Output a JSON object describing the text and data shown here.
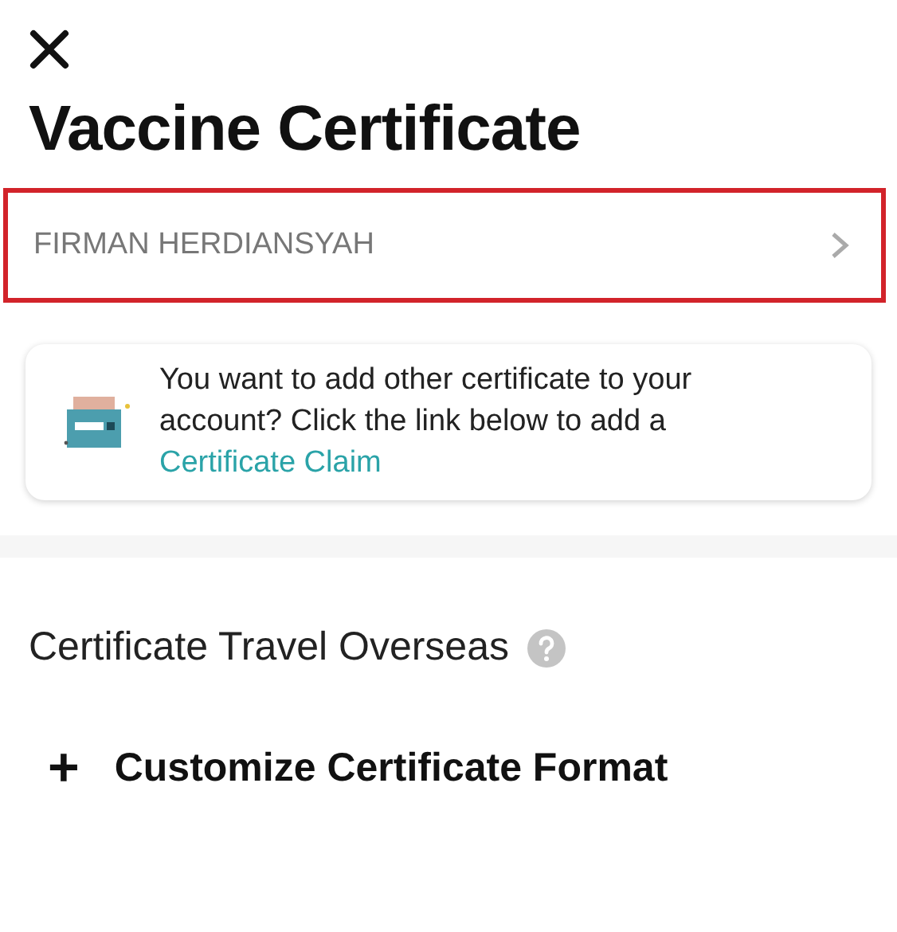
{
  "title": "Vaccine Certificate",
  "holder": {
    "name": "FIRMAN HERDIANSYAH",
    "highlighted": true
  },
  "claim_card": {
    "text": "You want to add other certificate to your account? Click the link below to add a",
    "link": "Certificate Claim"
  },
  "travel_section": {
    "title": "Certificate Travel Overseas"
  },
  "actions": [
    {
      "icon": "+",
      "label": "Customize Certificate Format"
    }
  ]
}
